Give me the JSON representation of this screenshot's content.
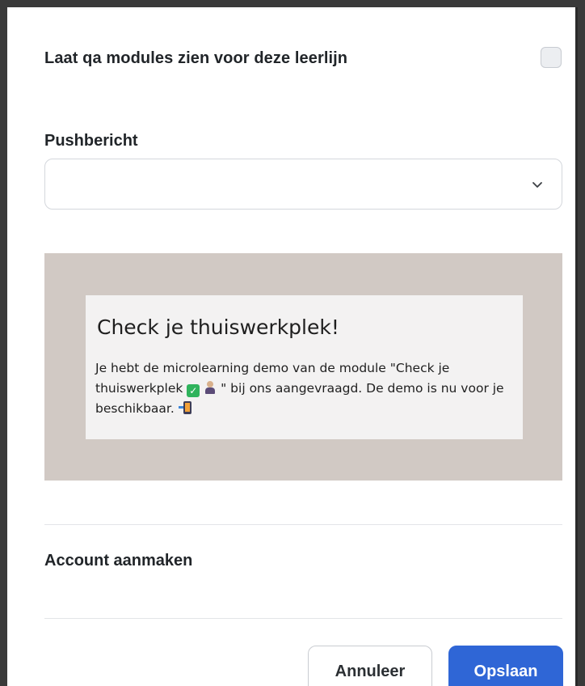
{
  "settings": {
    "qa_label": "Laat qa modules zien voor deze leerlijn",
    "qa_checked": false
  },
  "push": {
    "label": "Pushbericht",
    "selected_value": ""
  },
  "preview": {
    "title": "Check je thuiswerkplek!",
    "body_part1": "Je hebt de microlearning demo van de module \"Check je thuiswerkplek ",
    "body_part2": " \" bij ons aangevraagd. De demo is nu voor je beschikbaar. ",
    "background_color": "#d1c9c4",
    "card_color": "#f3f2f2",
    "emojis": [
      "check-mark-emoji",
      "person-at-computer-emoji",
      "phone-with-arrow-emoji"
    ]
  },
  "account": {
    "label": "Account aanmaken"
  },
  "buttons": {
    "cancel_label": "Annuleer",
    "save_label": "Opslaan",
    "save_color": "#2f66d6"
  }
}
